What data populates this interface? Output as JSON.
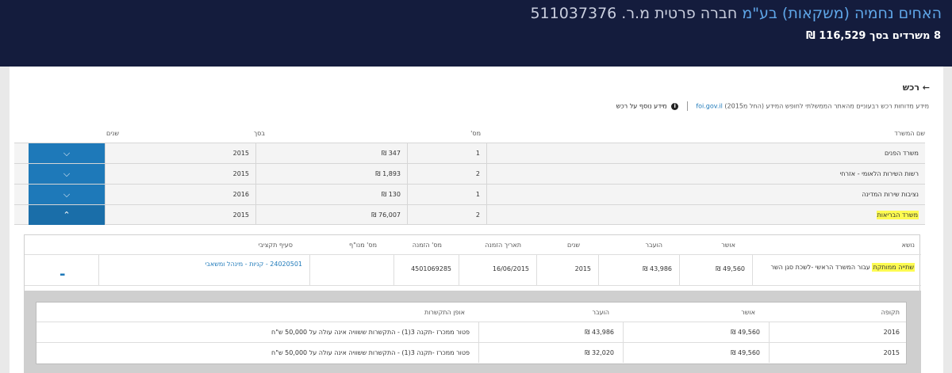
{
  "header": {
    "company_name": "האחים נחמיה (משקאות) בע\"מ",
    "company_type": "חברה פרטית",
    "registration_label": "מ.ר.",
    "registration_number": "511037376",
    "summary": "8 משרדים בסך 116,529 ₪"
  },
  "nav": {
    "back_label": "← רכש"
  },
  "source": {
    "text": "מידע מדוחות רכש רבעוניים מהאתר הממשלתי לחופש המידע (החל מ2015)",
    "site": "foi.gov.il",
    "more_info": "מידע נוסף על רכש"
  },
  "table": {
    "headers": {
      "office": "שם המשרד",
      "count": "מס'",
      "amount": "בסך",
      "years": "שנים"
    },
    "rows": [
      {
        "office": "משרד הפנים",
        "count": "1",
        "amount": "347 ₪",
        "years": "2015",
        "expanded": false
      },
      {
        "office": "רשות השירות הלאומי - אזרחי",
        "count": "2",
        "amount": "1,893 ₪",
        "years": "2015",
        "expanded": false
      },
      {
        "office": "נציבות שירות המדינה",
        "count": "1",
        "amount": "130 ₪",
        "years": "2016",
        "expanded": false
      },
      {
        "office": "משרד הבריאות",
        "count": "2",
        "amount": "76,007 ₪",
        "years": "2015",
        "expanded": true
      }
    ]
  },
  "detail": {
    "headers": {
      "subject": "נושא",
      "approved": "אושר",
      "transferred": "הועבר",
      "years": "שנים",
      "order_date": "תאריך הזמנה",
      "order_number": "מס' הזמנה",
      "supplier_number": "מס' מנו\"ף",
      "budget_item": "סעיף תקציבי"
    },
    "row": {
      "subject_highlight": "שתייה ממותקת",
      "subject_rest": "עבור המשרד הראשי -לשכת סגן השר",
      "approved": "49,560 ₪",
      "transferred": "43,986 ₪",
      "years": "2015",
      "order_date": "16/06/2015",
      "order_number": "4501069285",
      "supplier_number": "",
      "budget_item": "24020501 - קניות - מינהל ומשאבי"
    },
    "collapse_label": "-"
  },
  "periods": {
    "headers": {
      "period": "תקופה",
      "approved": "אושר",
      "transferred": "הועבר",
      "engagement": "אופן התקשרות"
    },
    "rows": [
      {
        "period": "2016",
        "approved": "49,560 ₪",
        "transferred": "43,986 ₪",
        "engagement": "פטור ממכרז -תקנה 3(1) - התקשרות ששוויה אינה עולה על 50,000 ש\"ח"
      },
      {
        "period": "2015",
        "approved": "49,560 ₪",
        "transferred": "32,020 ₪",
        "engagement": "פטור ממכרז -תקנה 3(1) - התקשרות ששוויה אינה עולה על 50,000 ש\"ח"
      }
    ]
  },
  "colors": {
    "header_bg": "#141c3d",
    "accent": "#1e79b9",
    "highlight": "#fdfb51"
  }
}
